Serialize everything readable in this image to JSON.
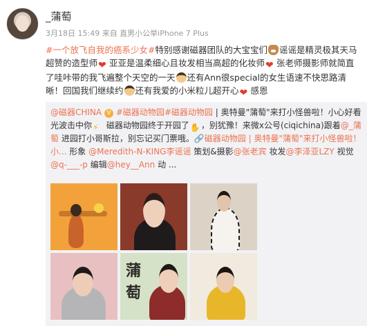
{
  "post": {
    "user_name": "_蒲萄",
    "meta": "3月18日 15:49 来自 直男小公举iPhone 7 Plus",
    "content": [
      {
        "t": "link",
        "v": "#一个放飞自我的癌系少女#"
      },
      {
        "t": "text",
        "v": "特别感谢磁器团队的大宝宝们"
      },
      {
        "t": "emoji",
        "icon": "dog-face-icon"
      },
      {
        "t": "text",
        "v": "谣谣是精灵极其天马超赞的造型师"
      },
      {
        "t": "emoji",
        "icon": "heart-icon"
      },
      {
        "t": "text",
        "v": "亚亚是温柔细心且妆发相当高超的化妆师"
      },
      {
        "t": "emoji",
        "icon": "heart-icon"
      },
      {
        "t": "text",
        "v": "张老师摄影师就简直了哇咔带的我飞遍整个天空的一天"
      },
      {
        "t": "emoji",
        "icon": "face-icon"
      },
      {
        "t": "text",
        "v": "还有Ann很special的女生语速不快思路清晰！回国我们继续约"
      },
      {
        "t": "emoji",
        "icon": "face-icon"
      },
      {
        "t": "text",
        "v": "还有我爱的小米粒儿超开心"
      },
      {
        "t": "emoji",
        "icon": "heart-icon"
      },
      {
        "t": "text",
        "v": "感恩"
      }
    ]
  },
  "repost": {
    "source": "@磁器CHINA",
    "badge": "V",
    "content": [
      {
        "t": "link",
        "v": "#磁器动物园#磁器动物园"
      },
      {
        "t": "text",
        "v": " | 奥特曼\"蒲萄\"来打小怪兽啦！小心好看光波击中你"
      },
      {
        "t": "emoji",
        "icon": "lightning-icon"
      },
      {
        "t": "text",
        "v": " 磁器动物园终于开园了"
      },
      {
        "t": "emoji",
        "icon": "clap-icon"
      },
      {
        "t": "text",
        "v": "，别犹豫！来微x公号(ciqichina)跟着"
      },
      {
        "t": "link",
        "v": "@_蒲萄"
      },
      {
        "t": "text",
        "v": " 进园打小哥斯拉，别忘记买门票哦。"
      },
      {
        "t": "link",
        "v": "🔗磁器动物园 | 奥特曼\"蒲萄\"来打小怪兽啦！小..."
      },
      {
        "t": "text",
        "v": " 形象 "
      },
      {
        "t": "link",
        "v": "@Meredith-N-KING李谣谣"
      },
      {
        "t": "text",
        "v": " 策划&摄影"
      },
      {
        "t": "link",
        "v": "@张老宾"
      },
      {
        "t": "text",
        "v": " 妆发"
      },
      {
        "t": "link",
        "v": "@李泽亚LZY"
      },
      {
        "t": "text",
        "v": " 视觉"
      },
      {
        "t": "link",
        "v": "@q-___-p"
      },
      {
        "t": "text",
        "v": " 编辑"
      },
      {
        "t": "link",
        "v": "@hey__Ann"
      },
      {
        "t": "text",
        "v": " 动 ..."
      }
    ],
    "photo_overlay_text": [
      "蒲",
      "萄"
    ]
  },
  "colors": {
    "link": "#eb7350",
    "repost_bg": "#f2f2f5",
    "meta": "#999999"
  }
}
